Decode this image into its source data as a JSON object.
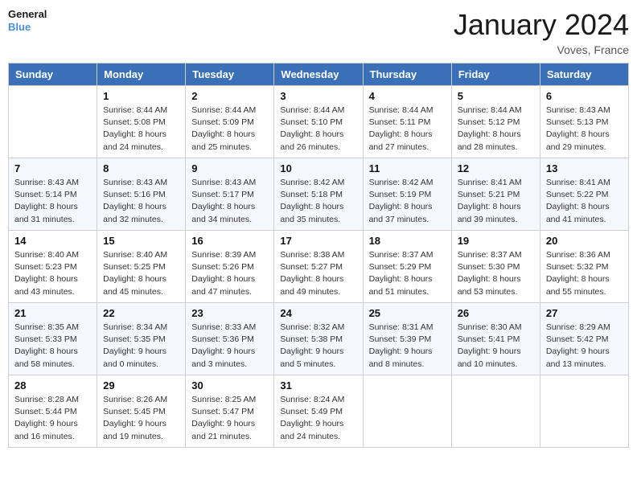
{
  "header": {
    "logo_line1": "General",
    "logo_line2": "Blue",
    "month_year": "January 2024",
    "location": "Voves, France"
  },
  "columns": [
    "Sunday",
    "Monday",
    "Tuesday",
    "Wednesday",
    "Thursday",
    "Friday",
    "Saturday"
  ],
  "weeks": [
    [
      {
        "day": "",
        "sunrise": "",
        "sunset": "",
        "daylight": ""
      },
      {
        "day": "1",
        "sunrise": "Sunrise: 8:44 AM",
        "sunset": "Sunset: 5:08 PM",
        "daylight": "Daylight: 8 hours and 24 minutes."
      },
      {
        "day": "2",
        "sunrise": "Sunrise: 8:44 AM",
        "sunset": "Sunset: 5:09 PM",
        "daylight": "Daylight: 8 hours and 25 minutes."
      },
      {
        "day": "3",
        "sunrise": "Sunrise: 8:44 AM",
        "sunset": "Sunset: 5:10 PM",
        "daylight": "Daylight: 8 hours and 26 minutes."
      },
      {
        "day": "4",
        "sunrise": "Sunrise: 8:44 AM",
        "sunset": "Sunset: 5:11 PM",
        "daylight": "Daylight: 8 hours and 27 minutes."
      },
      {
        "day": "5",
        "sunrise": "Sunrise: 8:44 AM",
        "sunset": "Sunset: 5:12 PM",
        "daylight": "Daylight: 8 hours and 28 minutes."
      },
      {
        "day": "6",
        "sunrise": "Sunrise: 8:43 AM",
        "sunset": "Sunset: 5:13 PM",
        "daylight": "Daylight: 8 hours and 29 minutes."
      }
    ],
    [
      {
        "day": "7",
        "sunrise": "Sunrise: 8:43 AM",
        "sunset": "Sunset: 5:14 PM",
        "daylight": "Daylight: 8 hours and 31 minutes."
      },
      {
        "day": "8",
        "sunrise": "Sunrise: 8:43 AM",
        "sunset": "Sunset: 5:16 PM",
        "daylight": "Daylight: 8 hours and 32 minutes."
      },
      {
        "day": "9",
        "sunrise": "Sunrise: 8:43 AM",
        "sunset": "Sunset: 5:17 PM",
        "daylight": "Daylight: 8 hours and 34 minutes."
      },
      {
        "day": "10",
        "sunrise": "Sunrise: 8:42 AM",
        "sunset": "Sunset: 5:18 PM",
        "daylight": "Daylight: 8 hours and 35 minutes."
      },
      {
        "day": "11",
        "sunrise": "Sunrise: 8:42 AM",
        "sunset": "Sunset: 5:19 PM",
        "daylight": "Daylight: 8 hours and 37 minutes."
      },
      {
        "day": "12",
        "sunrise": "Sunrise: 8:41 AM",
        "sunset": "Sunset: 5:21 PM",
        "daylight": "Daylight: 8 hours and 39 minutes."
      },
      {
        "day": "13",
        "sunrise": "Sunrise: 8:41 AM",
        "sunset": "Sunset: 5:22 PM",
        "daylight": "Daylight: 8 hours and 41 minutes."
      }
    ],
    [
      {
        "day": "14",
        "sunrise": "Sunrise: 8:40 AM",
        "sunset": "Sunset: 5:23 PM",
        "daylight": "Daylight: 8 hours and 43 minutes."
      },
      {
        "day": "15",
        "sunrise": "Sunrise: 8:40 AM",
        "sunset": "Sunset: 5:25 PM",
        "daylight": "Daylight: 8 hours and 45 minutes."
      },
      {
        "day": "16",
        "sunrise": "Sunrise: 8:39 AM",
        "sunset": "Sunset: 5:26 PM",
        "daylight": "Daylight: 8 hours and 47 minutes."
      },
      {
        "day": "17",
        "sunrise": "Sunrise: 8:38 AM",
        "sunset": "Sunset: 5:27 PM",
        "daylight": "Daylight: 8 hours and 49 minutes."
      },
      {
        "day": "18",
        "sunrise": "Sunrise: 8:37 AM",
        "sunset": "Sunset: 5:29 PM",
        "daylight": "Daylight: 8 hours and 51 minutes."
      },
      {
        "day": "19",
        "sunrise": "Sunrise: 8:37 AM",
        "sunset": "Sunset: 5:30 PM",
        "daylight": "Daylight: 8 hours and 53 minutes."
      },
      {
        "day": "20",
        "sunrise": "Sunrise: 8:36 AM",
        "sunset": "Sunset: 5:32 PM",
        "daylight": "Daylight: 8 hours and 55 minutes."
      }
    ],
    [
      {
        "day": "21",
        "sunrise": "Sunrise: 8:35 AM",
        "sunset": "Sunset: 5:33 PM",
        "daylight": "Daylight: 8 hours and 58 minutes."
      },
      {
        "day": "22",
        "sunrise": "Sunrise: 8:34 AM",
        "sunset": "Sunset: 5:35 PM",
        "daylight": "Daylight: 9 hours and 0 minutes."
      },
      {
        "day": "23",
        "sunrise": "Sunrise: 8:33 AM",
        "sunset": "Sunset: 5:36 PM",
        "daylight": "Daylight: 9 hours and 3 minutes."
      },
      {
        "day": "24",
        "sunrise": "Sunrise: 8:32 AM",
        "sunset": "Sunset: 5:38 PM",
        "daylight": "Daylight: 9 hours and 5 minutes."
      },
      {
        "day": "25",
        "sunrise": "Sunrise: 8:31 AM",
        "sunset": "Sunset: 5:39 PM",
        "daylight": "Daylight: 9 hours and 8 minutes."
      },
      {
        "day": "26",
        "sunrise": "Sunrise: 8:30 AM",
        "sunset": "Sunset: 5:41 PM",
        "daylight": "Daylight: 9 hours and 10 minutes."
      },
      {
        "day": "27",
        "sunrise": "Sunrise: 8:29 AM",
        "sunset": "Sunset: 5:42 PM",
        "daylight": "Daylight: 9 hours and 13 minutes."
      }
    ],
    [
      {
        "day": "28",
        "sunrise": "Sunrise: 8:28 AM",
        "sunset": "Sunset: 5:44 PM",
        "daylight": "Daylight: 9 hours and 16 minutes."
      },
      {
        "day": "29",
        "sunrise": "Sunrise: 8:26 AM",
        "sunset": "Sunset: 5:45 PM",
        "daylight": "Daylight: 9 hours and 19 minutes."
      },
      {
        "day": "30",
        "sunrise": "Sunrise: 8:25 AM",
        "sunset": "Sunset: 5:47 PM",
        "daylight": "Daylight: 9 hours and 21 minutes."
      },
      {
        "day": "31",
        "sunrise": "Sunrise: 8:24 AM",
        "sunset": "Sunset: 5:49 PM",
        "daylight": "Daylight: 9 hours and 24 minutes."
      },
      {
        "day": "",
        "sunrise": "",
        "sunset": "",
        "daylight": ""
      },
      {
        "day": "",
        "sunrise": "",
        "sunset": "",
        "daylight": ""
      },
      {
        "day": "",
        "sunrise": "",
        "sunset": "",
        "daylight": ""
      }
    ]
  ]
}
